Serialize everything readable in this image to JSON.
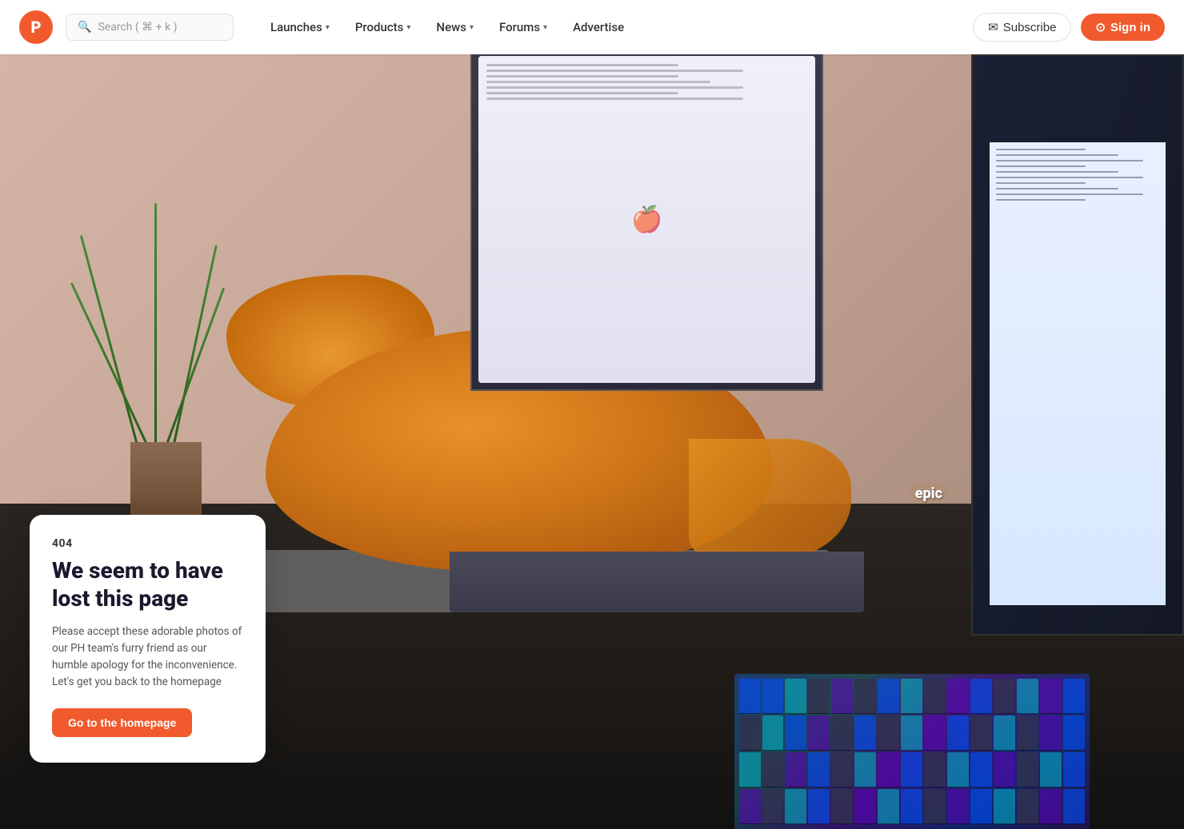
{
  "navbar": {
    "logo_letter": "P",
    "search_placeholder": "Search ( ⌘ + k )",
    "nav_items": [
      {
        "label": "Launches",
        "has_chevron": true
      },
      {
        "label": "Products",
        "has_chevron": true
      },
      {
        "label": "News",
        "has_chevron": true
      },
      {
        "label": "Forums",
        "has_chevron": true
      },
      {
        "label": "Advertise",
        "has_chevron": false
      }
    ],
    "subscribe_label": "Subscribe",
    "signin_label": "Sign in"
  },
  "error_card": {
    "code": "404",
    "title": "We seem to have lost this page",
    "description": "Please accept these adorable photos of our PH team's furry friend as our humble apology for the inconvenience. Let's get you back to the homepage",
    "cta_label": "Go to the homepage"
  },
  "colors": {
    "brand_orange": "#f15a2d",
    "text_dark": "#1a1a2e",
    "text_gray": "#555",
    "error_code_color": "#37363f"
  }
}
